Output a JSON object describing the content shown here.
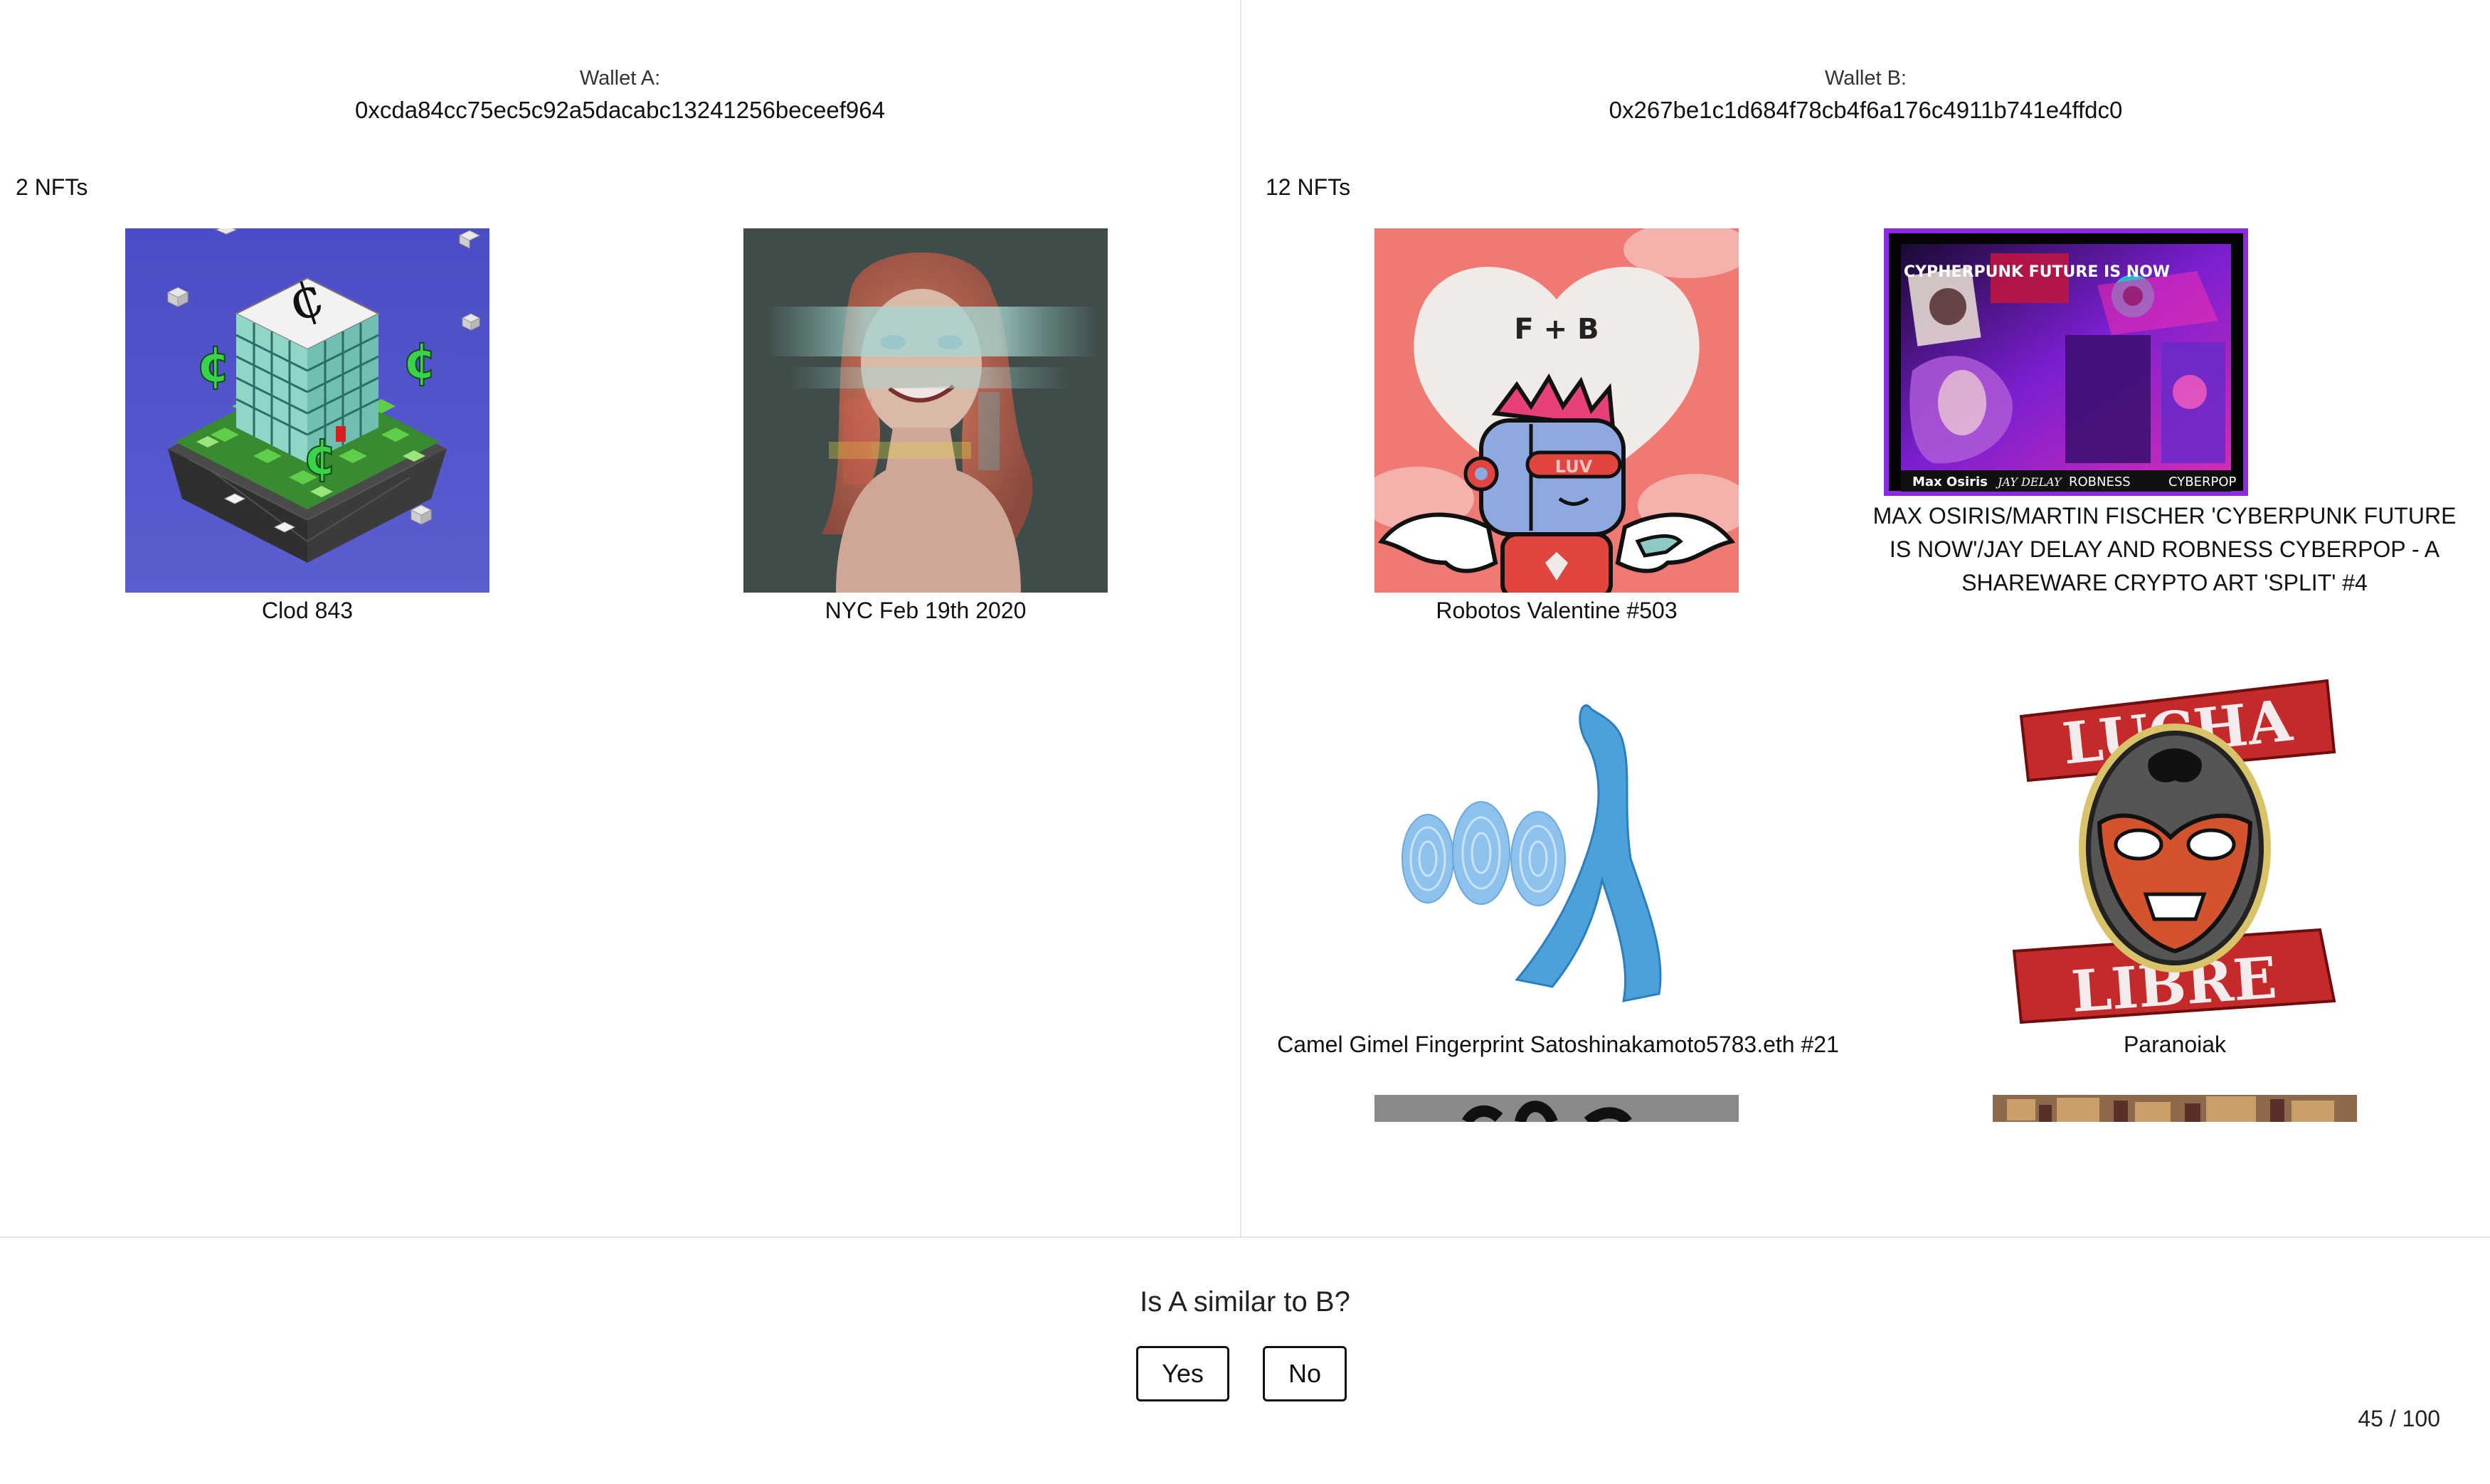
{
  "wallet_a": {
    "label": "Wallet A:",
    "address": "0xcda84cc75ec5c92a5dacabc13241256beceef964",
    "count_text": "2 NFTs",
    "nfts": [
      {
        "name": "Clod 843"
      },
      {
        "name": "NYC Feb 19th 2020"
      }
    ]
  },
  "wallet_b": {
    "label": "Wallet B:",
    "address": "0x267be1c1d684f78cb4f6a176c4911b741e4ffdc0",
    "count_text": "12 NFTs",
    "nfts": [
      {
        "name": "Robotos Valentine #503",
        "image_text": [
          "F + B",
          "LUV"
        ]
      },
      {
        "name": "MAX OSIRIS/MARTIN FISCHER 'CYBERPUNK FUTURE IS NOW'/JAY DELAY AND ROBNESS CYBERPOP - A SHAREWARE CRYPTO ART 'SPLIT' #4",
        "image_text": [
          "CYPHERPUNK FUTURE IS NOW",
          "Max Osiris",
          "JAY DELAY",
          "ROBNESS",
          "CYBERPOP"
        ]
      },
      {
        "name": "Camel Gimel Fingerprint Satoshinakamoto5783.eth #21"
      },
      {
        "name": "Paranoiak",
        "image_text": [
          "LUCHA",
          "LIBRE"
        ]
      }
    ]
  },
  "prompt": {
    "question": "Is A similar to B?",
    "yes_label": "Yes",
    "no_label": "No",
    "progress": "45 / 100"
  },
  "colors": {
    "border": "#e4e4e4",
    "button_border": "#111111"
  }
}
